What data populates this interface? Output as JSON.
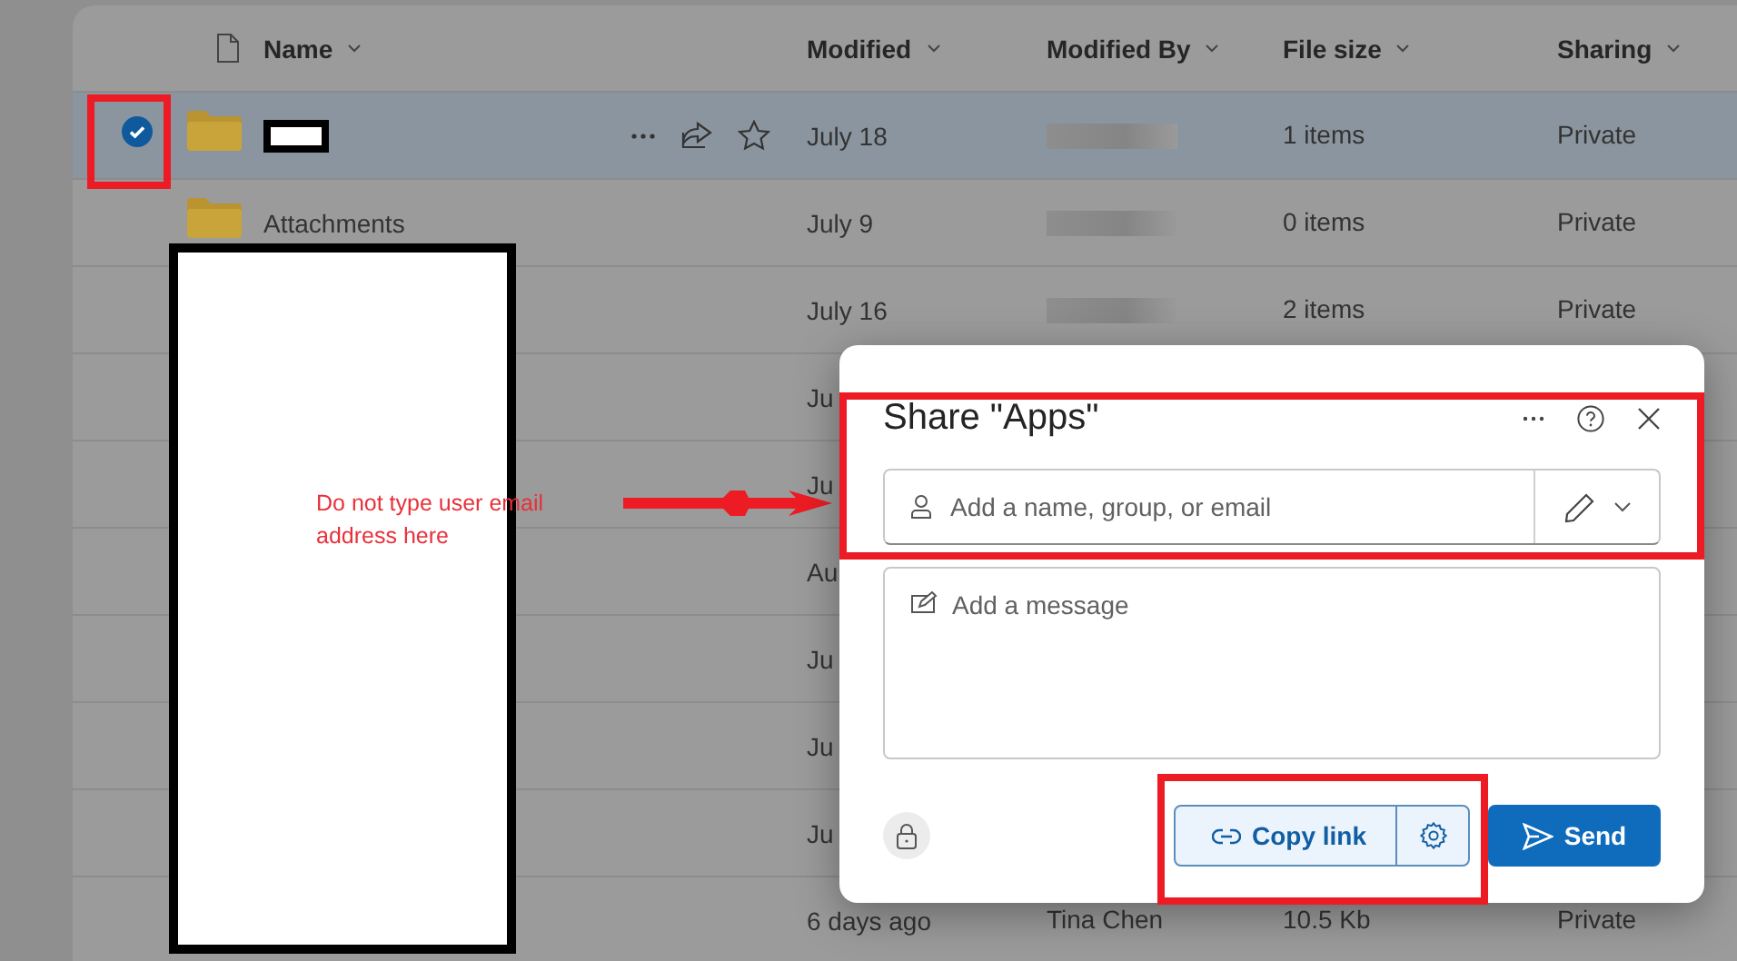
{
  "file_list": {
    "columns": [
      {
        "label": "Name"
      },
      {
        "label": "Modified"
      },
      {
        "label": "Modified By"
      },
      {
        "label": "File size"
      },
      {
        "label": "Sharing"
      }
    ],
    "rows": [
      {
        "selected": true,
        "kind": "folder",
        "name_redacted": true,
        "actions": true,
        "modified": "July 18",
        "modified_by_redacted": true,
        "file_size": "1 items",
        "sharing": "Private"
      },
      {
        "selected": false,
        "kind": "folder",
        "name": "Attachments",
        "modified": "July 9",
        "modified_by_redacted": true,
        "file_size": "0 items",
        "sharing": "Private"
      },
      {
        "selected": false,
        "modified": "July 16",
        "modified_by_redacted": true,
        "file_size": "2 items",
        "sharing": "Private"
      },
      {
        "selected": false,
        "modified": "Ju"
      },
      {
        "selected": false,
        "modified": "Ju"
      },
      {
        "selected": false,
        "modified": "Au"
      },
      {
        "selected": false,
        "modified": "Ju"
      },
      {
        "selected": false,
        "modified": "Ju"
      },
      {
        "selected": false,
        "modified": "Ju"
      },
      {
        "selected": false,
        "modified": "6 days ago",
        "modified_by": "Tina Chen",
        "file_size": "10.5 Kb",
        "sharing": "Private"
      }
    ]
  },
  "share_dialog": {
    "title": "Share \"Apps\"",
    "people_field": {
      "placeholder": "Add a name, group, or email"
    },
    "message_field": {
      "placeholder": "Add a message"
    },
    "copy_link_button": "Copy link",
    "send_button": "Send"
  },
  "annotation": {
    "note": "Do not type user email address here"
  }
}
